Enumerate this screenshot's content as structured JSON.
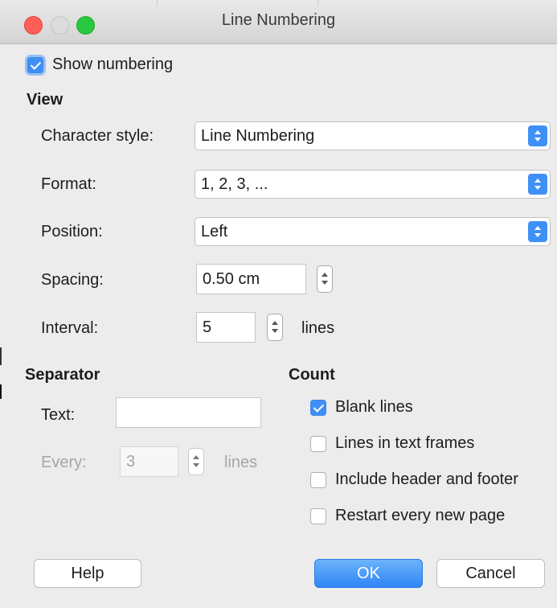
{
  "window": {
    "title": "Line Numbering"
  },
  "show_numbering": {
    "label": "Show numbering",
    "checked": true
  },
  "view": {
    "heading": "View",
    "character_style": {
      "label": "Character style:",
      "value": "Line Numbering"
    },
    "format": {
      "label": "Format:",
      "value": "1, 2, 3, ..."
    },
    "position": {
      "label": "Position:",
      "value": "Left"
    },
    "spacing": {
      "label": "Spacing:",
      "value": "0.50 cm"
    },
    "interval": {
      "label": "Interval:",
      "value": "5",
      "unit": "lines"
    }
  },
  "separator": {
    "heading": "Separator",
    "text": {
      "label": "Text:",
      "value": ""
    },
    "every": {
      "label": "Every:",
      "value": "3",
      "unit": "lines"
    }
  },
  "count": {
    "heading": "Count",
    "options": [
      {
        "label": "Blank lines",
        "checked": true
      },
      {
        "label": "Lines in text frames",
        "checked": false
      },
      {
        "label": "Include header and footer",
        "checked": false
      },
      {
        "label": "Restart every new page",
        "checked": false
      }
    ]
  },
  "buttons": {
    "help": "Help",
    "ok": "OK",
    "cancel": "Cancel"
  },
  "colors": {
    "accent": "#3f90f6",
    "window_bg": "#ececec"
  }
}
